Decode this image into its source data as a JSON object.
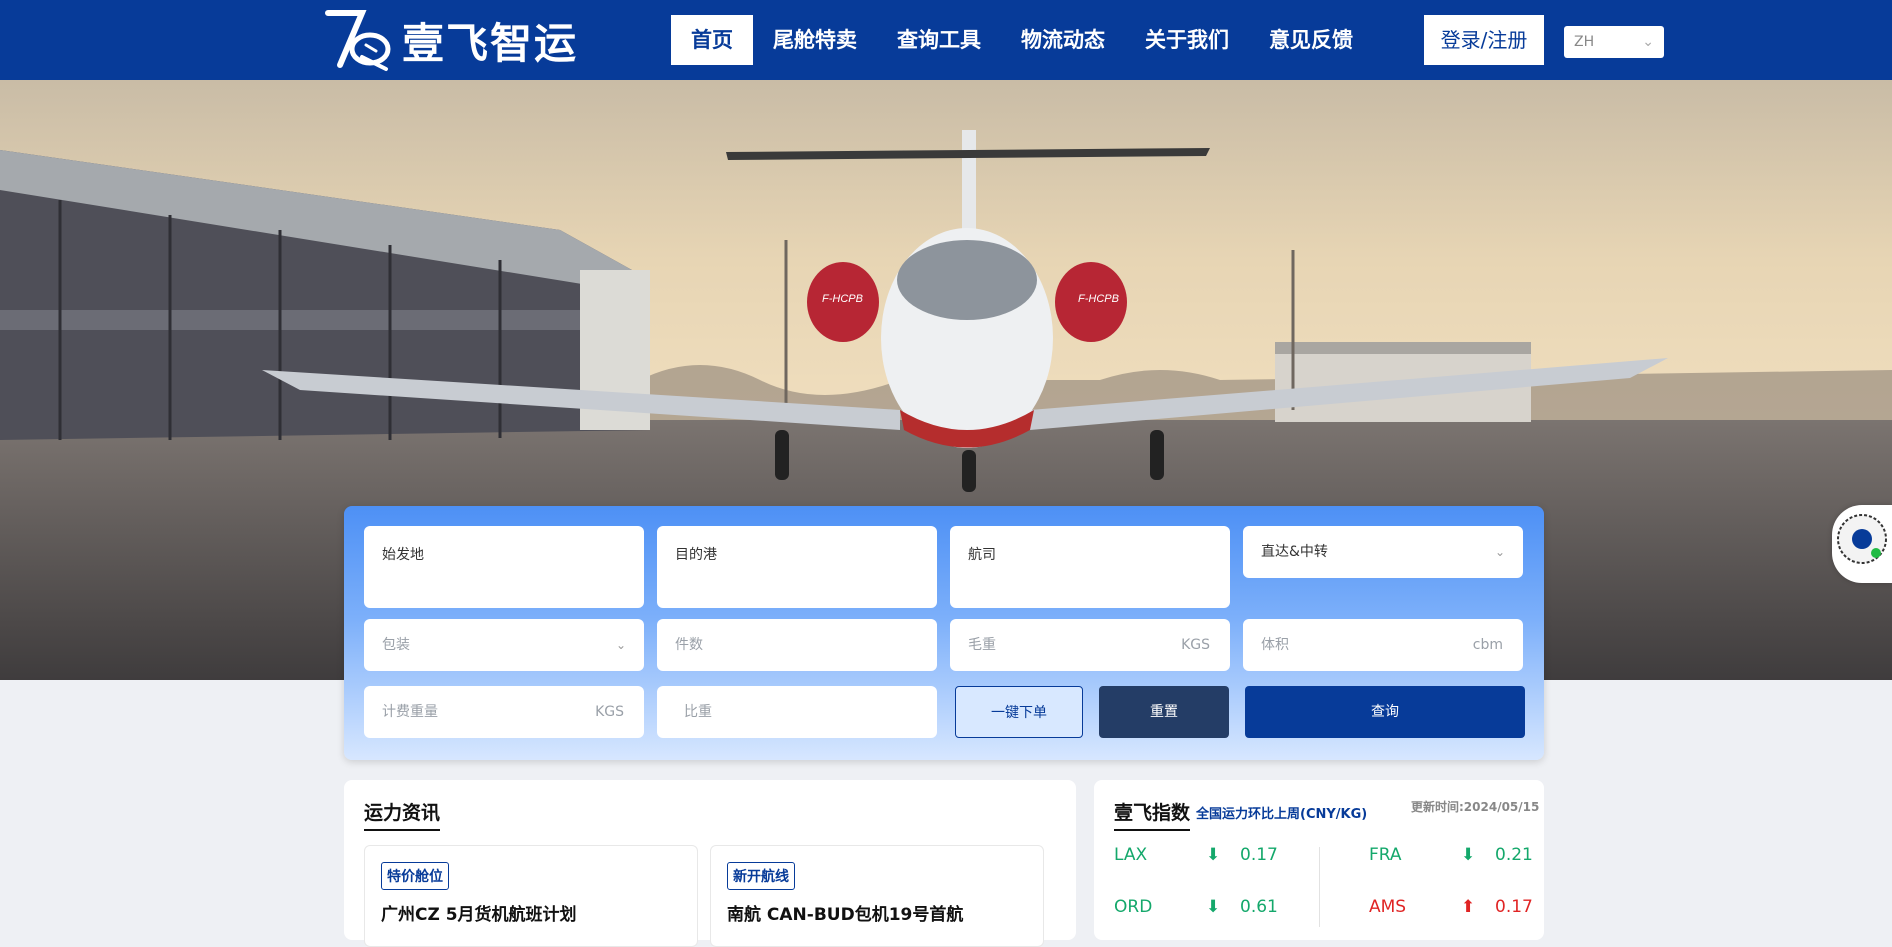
{
  "brand": {
    "name": "壹飞智运"
  },
  "nav": {
    "items": [
      "首页",
      "尾舱特卖",
      "查询工具",
      "物流动态",
      "关于我们",
      "意见反馈"
    ],
    "login_label": "登录/注册",
    "language": "ZH"
  },
  "hero": {
    "plane_registration": "F-HCPB"
  },
  "search": {
    "origin_placeholder": "始发地",
    "destination_placeholder": "目的港",
    "airline_placeholder": "航司",
    "route_type": "直达&中转",
    "package_placeholder": "包装",
    "pieces_placeholder": "件数",
    "gross_weight_placeholder": "毛重",
    "gross_weight_unit": "KGS",
    "volume_placeholder": "体积",
    "volume_unit": "cbm",
    "chargeable_weight_placeholder": "计费重量",
    "chargeable_weight_unit": "KGS",
    "density_placeholder": "比重",
    "quick_order_label": "一键下单",
    "reset_label": "重置",
    "query_label": "查询"
  },
  "news": {
    "title": "运力资讯",
    "items": [
      {
        "tag": "特价舱位",
        "title": "广州CZ 5月货机航班计划"
      },
      {
        "tag": "新开航线",
        "title": "南航 CAN-BUD包机19号首航"
      }
    ]
  },
  "index": {
    "title": "壹飞指数",
    "subtitle": "全国运力环比上周(CNY/KG)",
    "updated": "更新时间:2024/05/15",
    "rows": [
      {
        "code": "LAX",
        "direction": "down",
        "value": "0.17"
      },
      {
        "code": "FRA",
        "direction": "down",
        "value": "0.21"
      },
      {
        "code": "ORD",
        "direction": "down",
        "value": "0.61"
      },
      {
        "code": "AMS",
        "direction": "up",
        "value": "0.17"
      }
    ]
  },
  "colors": {
    "brand_blue": "#073b99",
    "down_green": "#14a86b",
    "up_red": "#e02424"
  }
}
